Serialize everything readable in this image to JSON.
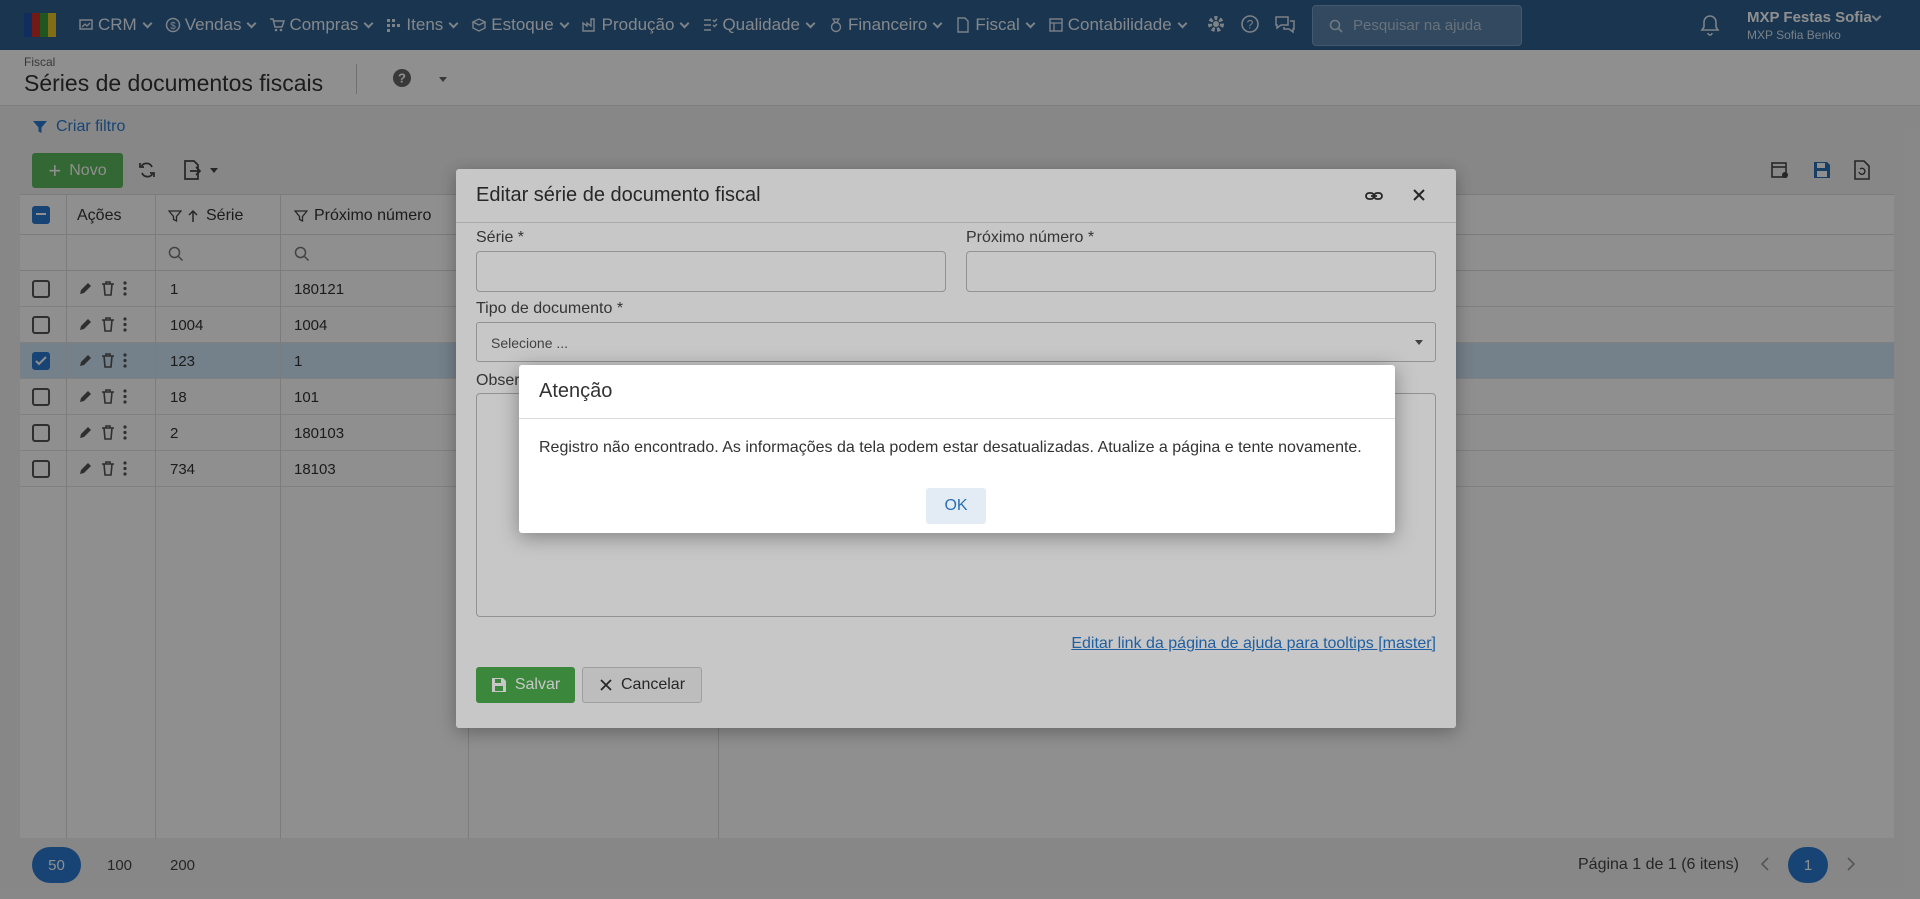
{
  "brand": {
    "colors": [
      "#1f4fa8",
      "#c9302c",
      "#3a9a3a",
      "#e6c229"
    ]
  },
  "nav": {
    "items": [
      {
        "label": "CRM",
        "icon": "crm-icon"
      },
      {
        "label": "Vendas",
        "icon": "dollar-icon"
      },
      {
        "label": "Compras",
        "icon": "cart-icon"
      },
      {
        "label": "Itens",
        "icon": "items-icon"
      },
      {
        "label": "Estoque",
        "icon": "stock-icon"
      },
      {
        "label": "Produção",
        "icon": "factory-icon"
      },
      {
        "label": "Qualidade",
        "icon": "quality-icon"
      },
      {
        "label": "Financeiro",
        "icon": "finance-icon"
      },
      {
        "label": "Fiscal",
        "icon": "fiscal-icon"
      },
      {
        "label": "Contabilidade",
        "icon": "accounting-icon"
      }
    ],
    "search_placeholder": "Pesquisar na ajuda",
    "user_name": "MXP Festas Sofia",
    "user_sub": "MXP Sofia Benko"
  },
  "page": {
    "breadcrumb": "Fiscal",
    "title": "Séries de documentos fiscais",
    "filter_link": "Criar filtro",
    "new_button": "Novo"
  },
  "grid": {
    "headers": {
      "actions": "Ações",
      "serie": "Série",
      "next": "Próximo número"
    },
    "rows": [
      {
        "serie": "1",
        "next": "180121",
        "selected": false
      },
      {
        "serie": "1004",
        "next": "1004",
        "selected": false
      },
      {
        "serie": "123",
        "next": "1",
        "selected": true
      },
      {
        "serie": "18",
        "next": "101",
        "selected": false
      },
      {
        "serie": "2",
        "next": "180103",
        "selected": false
      },
      {
        "serie": "734",
        "next": "18103",
        "selected": false
      }
    ]
  },
  "pager": {
    "sizes": [
      "50",
      "100",
      "200"
    ],
    "active_size": "50",
    "info": "Página 1 de 1 (6 itens)",
    "current_page": "1"
  },
  "dialog": {
    "title": "Editar série de documento fiscal",
    "serie_label": "Série *",
    "serie_value": "",
    "next_label": "Próximo número *",
    "next_value": "",
    "doctype_label": "Tipo de documento *",
    "doctype_value": "Selecione ...",
    "obs_label": "Obser",
    "help_link": "Editar link da página de ajuda para tooltips [master]",
    "save": "Salvar",
    "cancel": "Cancelar"
  },
  "alert": {
    "title": "Atenção",
    "message": "Registro não encontrado. As informações da tela podem estar desatualizadas. Atualize a página e tente novamente.",
    "ok": "OK"
  }
}
